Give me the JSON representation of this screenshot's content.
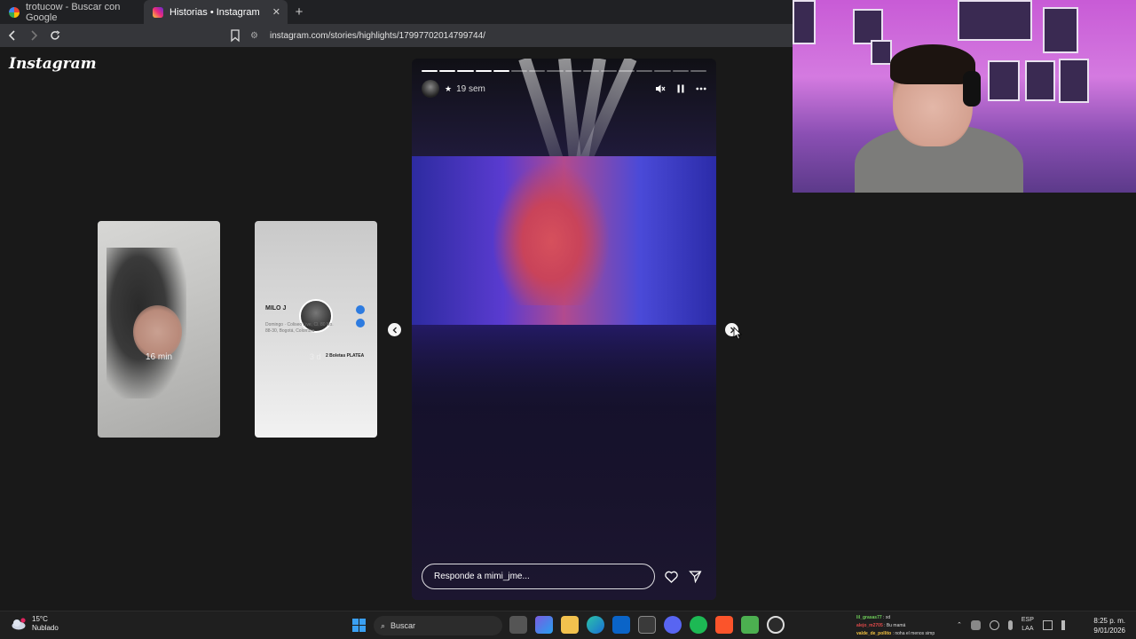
{
  "browser": {
    "tabs": [
      {
        "label": "trotucow - Buscar con Google",
        "active": false,
        "icon": "google-icon"
      },
      {
        "label": "Historias • Instagram",
        "active": true,
        "icon": "instagram-icon"
      }
    ],
    "close_glyph": "✕",
    "newtab_glyph": "+",
    "url": "instagram.com/stories/highlights/17997702014799744/"
  },
  "instagram": {
    "logo": "Instagram",
    "previews": [
      {
        "time": "16 min"
      },
      {
        "name": "MILO J",
        "detail": "Domingo · Coliseo Live, Cl. 80 No. 88-30, Bogotá, Colombia",
        "time": "3 d",
        "tickets": "2 Boletas PLATEA"
      }
    ],
    "story": {
      "segments_total": 16,
      "segments_done": 5,
      "time": "19 sem",
      "star": "★",
      "reply_placeholder": "Responde a mimi_jme..."
    }
  },
  "taskbar": {
    "weather_temp": "15°C",
    "weather_desc": "Nublado",
    "search_label": "Buscar",
    "chat": [
      {
        "user": "lil_grasas77",
        "msg": "xd"
      },
      {
        "user": "alejo_m2705",
        "msg": "Bu mamá"
      },
      {
        "user": "valde_de_pollito",
        "msg": "noha el menos simp"
      }
    ],
    "lang_top": "ESP",
    "lang_bottom": "LAA",
    "time": "8:25 p. m.",
    "date": "9/01/2026"
  },
  "colors": {
    "accent_blue": "#2d7be0",
    "story_purple": "#3b2a92",
    "webcam_pink": "#c85bd6"
  }
}
